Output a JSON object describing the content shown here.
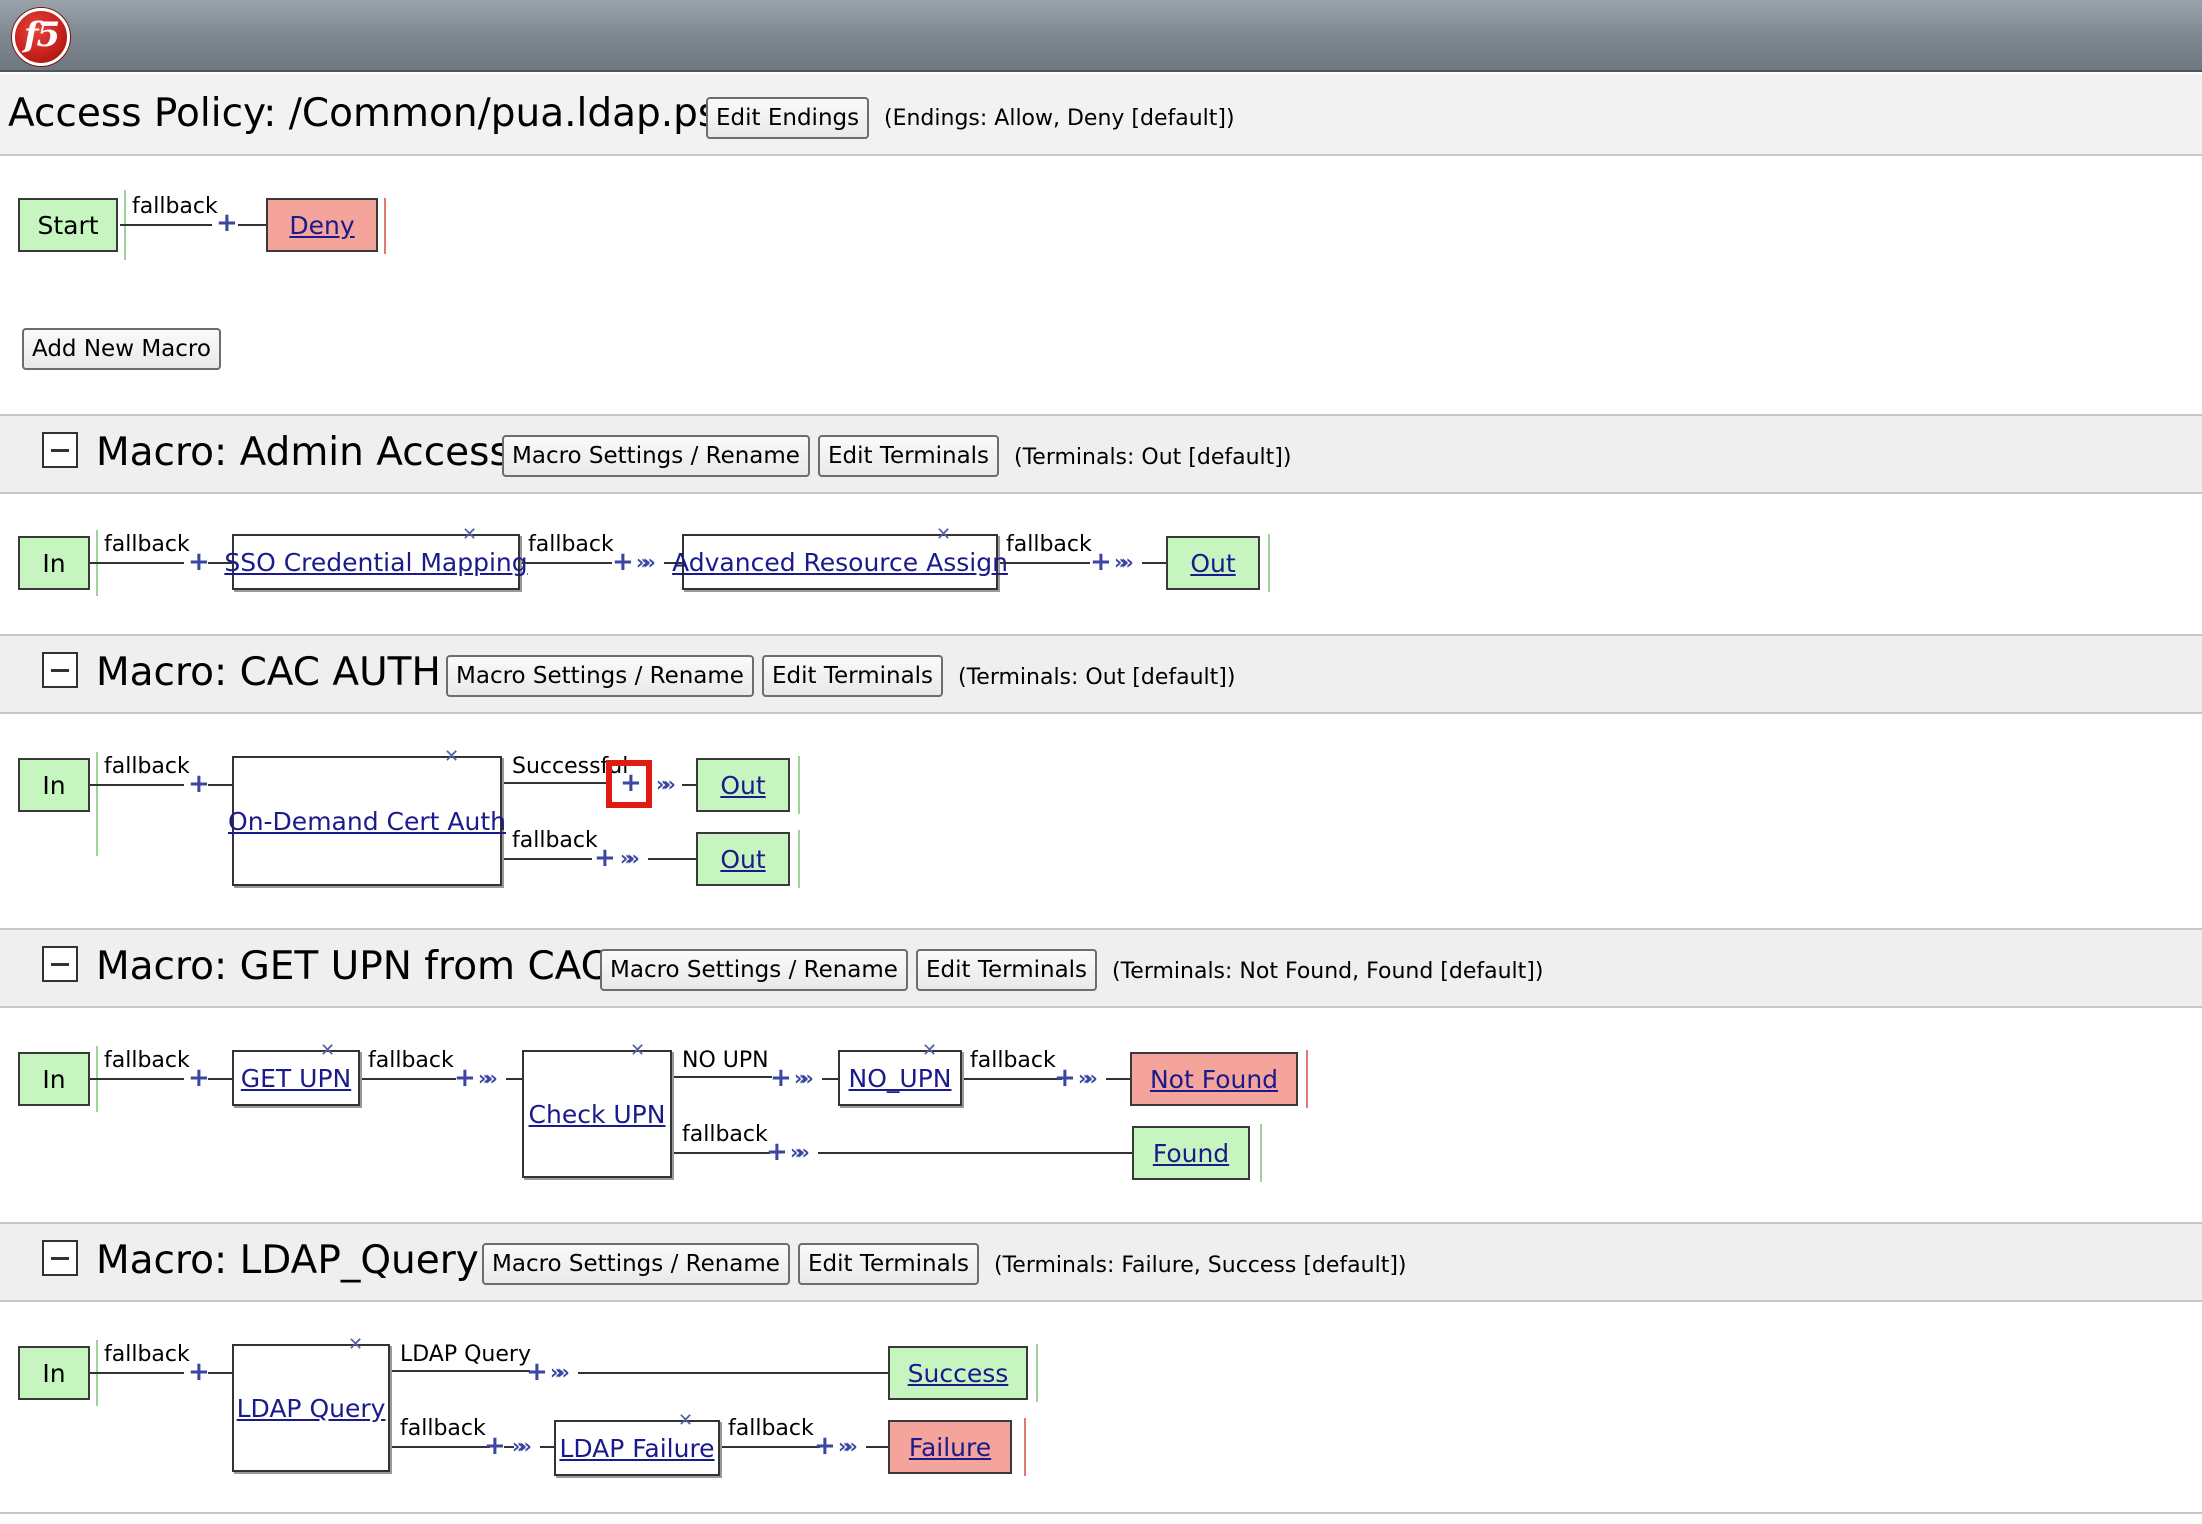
{
  "app": {
    "logo_text": "f5"
  },
  "policy": {
    "title": "Access Policy: /Common/pua.ldap.psp",
    "edit_endings_label": "Edit Endings",
    "endings_note": "(Endings: Allow, Deny [default])",
    "start_label": "Start",
    "branch_label": "fallback",
    "end_label": "Deny",
    "add_macro_label": "Add New Macro"
  },
  "macros": [
    {
      "title": "Macro: Admin Access",
      "settings_label": "Macro Settings / Rename",
      "terminals_label": "Edit Terminals",
      "terminals_note": "(Terminals: Out [default])",
      "in_label": "In",
      "branches": [
        "fallback",
        "fallback",
        "fallback"
      ],
      "items": [
        "SSO Credential Mapping",
        "Advanced Resource Assign"
      ],
      "out_label": "Out"
    },
    {
      "title": "Macro: CAC AUTH",
      "settings_label": "Macro Settings / Rename",
      "terminals_label": "Edit Terminals",
      "terminals_note": "(Terminals: Out [default])",
      "in_label": "In",
      "branches": [
        "fallback",
        "Successful",
        "fallback"
      ],
      "items": [
        "On-Demand Cert Auth"
      ],
      "outs": [
        "Out",
        "Out"
      ]
    },
    {
      "title": "Macro: GET UPN from CAC",
      "settings_label": "Macro Settings / Rename",
      "terminals_label": "Edit Terminals",
      "terminals_note": "(Terminals: Not Found, Found [default])",
      "in_label": "In",
      "branches": [
        "fallback",
        "fallback",
        "NO UPN",
        "fallback",
        "fallback"
      ],
      "items": [
        "GET UPN",
        "Check UPN",
        "NO_UPN"
      ],
      "outs": [
        "Not Found",
        "Found"
      ]
    },
    {
      "title": "Macro: LDAP_Query",
      "settings_label": "Macro Settings / Rename",
      "terminals_label": "Edit Terminals",
      "terminals_note": "(Terminals: Failure, Success [default])",
      "in_label": "In",
      "branches": [
        "fallback",
        "LDAP Query",
        "fallback",
        "fallback"
      ],
      "items": [
        "LDAP Query",
        "LDAP Failure"
      ],
      "outs": [
        "Success",
        "Failure"
      ]
    }
  ],
  "icons": {
    "delete": "close-x-icon",
    "add": "plus-icon",
    "arrow": "double-chevron-right-icon",
    "collapse": "minus-box-icon"
  },
  "colors": {
    "terminal_success": "#c6f5c0",
    "terminal_failure": "#f4a49a",
    "highlight": "#e01b14",
    "action_icon": "#3a46a0"
  }
}
